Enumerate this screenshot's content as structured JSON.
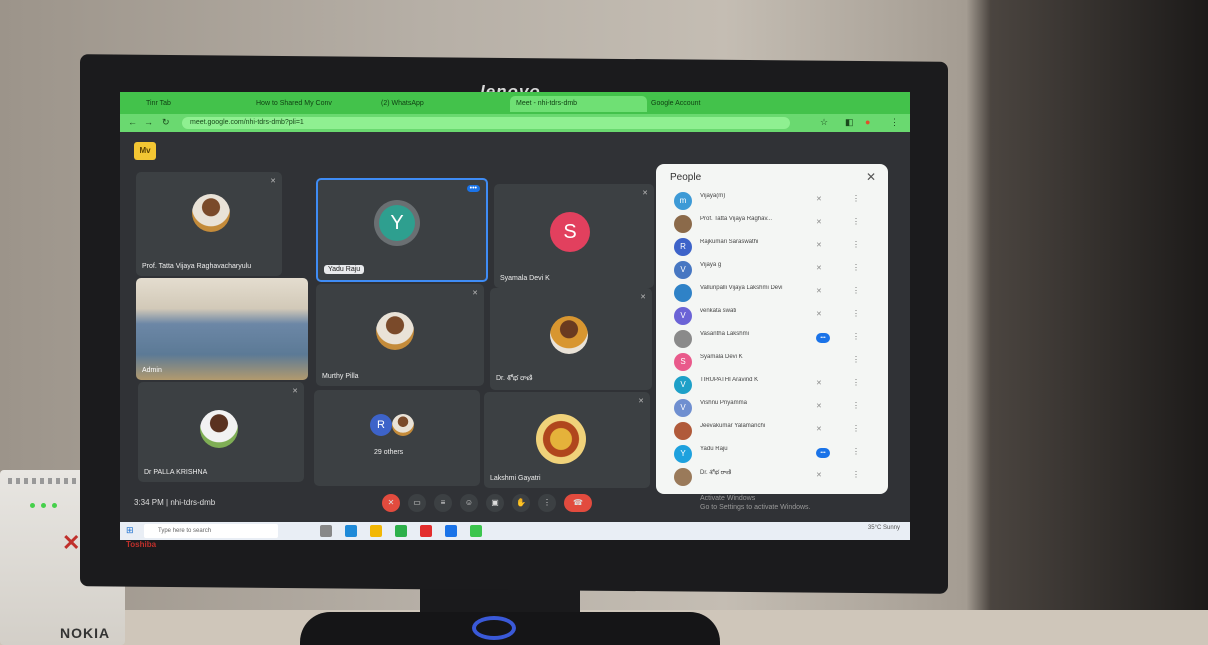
{
  "scene": {
    "monitor_brand": "lenovo",
    "bezel_label": "Toshiba",
    "router_brand": "NOKIA"
  },
  "browser": {
    "tabs": [
      {
        "label": "Tinr Tab"
      },
      {
        "label": "How to Shared My Conv"
      },
      {
        "label": "(2) WhatsApp"
      },
      {
        "label": "Meet - nhi-tdrs-dmb"
      },
      {
        "label": "Google Account"
      }
    ],
    "address": "meet.google.com/nhi-tdrs-dmb?pli=1"
  },
  "meet": {
    "tiles": [
      {
        "name": "Prof. Tatta Vijaya Raghavacharyulu"
      },
      {
        "name": "Yadu Raju",
        "initial": "Y"
      },
      {
        "name": "Syamala Devi K",
        "initial": "S"
      },
      {
        "name": "Admin"
      },
      {
        "name": "Murthy Pilla"
      },
      {
        "name": "Dr. శోభ రాణి"
      },
      {
        "name": "Dr PALLA KRISHNA"
      },
      {
        "name": "29 others",
        "initial": "R"
      },
      {
        "name": "Lakshmi Gayatri"
      }
    ],
    "clock": "3:34 PM",
    "meeting_code": "nhi-tdrs-dmb"
  },
  "people_panel": {
    "title": "People",
    "rows": [
      {
        "name": "Vijaya(m)",
        "initial": "m",
        "color": "#3d9ad6"
      },
      {
        "name": "Prof. Tatta Vijaya Raghav...",
        "initial": "",
        "color": "#8b6a4a"
      },
      {
        "name": "Rajkumari Saraswathi",
        "initial": "R",
        "color": "#3d63c9"
      },
      {
        "name": "Vijaya g",
        "initial": "V",
        "color": "#4777c2"
      },
      {
        "name": "Valluripalli Vijaya Lakshmi Devi",
        "initial": "",
        "color": "#2f82c7"
      },
      {
        "name": "venkata swati",
        "initial": "V",
        "color": "#6b63d6"
      },
      {
        "name": "Vasantha Lakshmi",
        "initial": "",
        "color": "#8a8a8a"
      },
      {
        "name": "Syamala Devi K",
        "initial": "S",
        "color": "#e95a8b"
      },
      {
        "name": "TIRUPATHI Aravind K",
        "initial": "V",
        "color": "#1da0c8"
      },
      {
        "name": "Vishnu Priyamma",
        "initial": "V",
        "color": "#6f8fd0"
      },
      {
        "name": "Jeevakumar Yalamanchi",
        "initial": "",
        "color": "#b05a3a"
      },
      {
        "name": "Yadu Raju",
        "initial": "Y",
        "color": "#1ea1de"
      },
      {
        "name": "Dr. శోభ రాణి",
        "initial": "",
        "color": "#9a7a5a"
      }
    ]
  },
  "os": {
    "search_placeholder": "Type here to search",
    "weather": "35°C Sunny",
    "activation": [
      "Activate Windows",
      "Go to Settings to activate Windows."
    ]
  }
}
